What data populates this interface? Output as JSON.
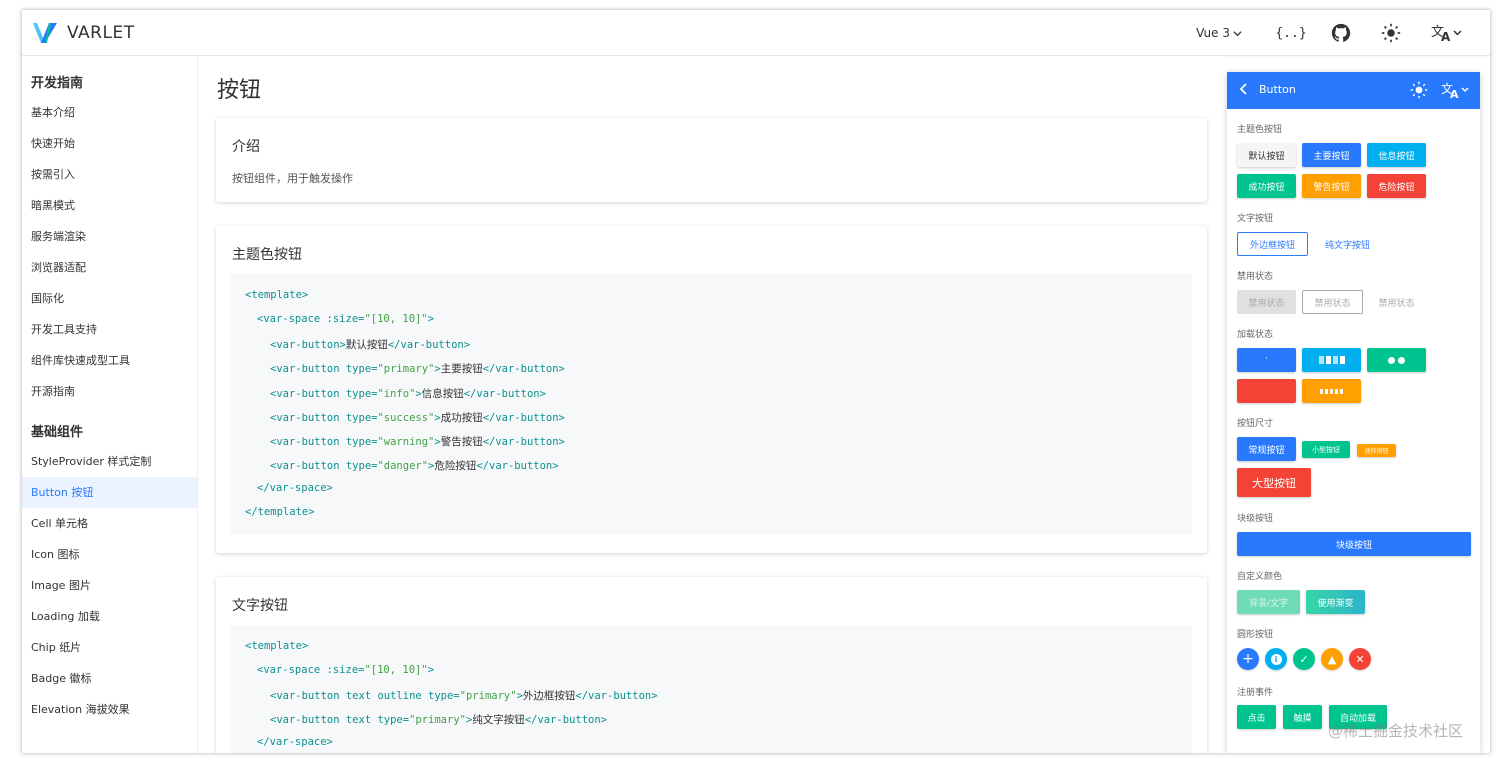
{
  "header": {
    "brand": "VARLET",
    "version": "Vue 3",
    "icons": [
      "logo-icon",
      "code-playground-icon",
      "github-icon",
      "theme-sun-icon",
      "language-icon"
    ]
  },
  "sidebar": {
    "groups": [
      {
        "title": "开发指南",
        "items": [
          "基本介绍",
          "快速开始",
          "按需引入",
          "暗黑模式",
          "服务端渲染",
          "浏览器适配",
          "国际化",
          "开发工具支持",
          "组件库快速成型工具",
          "开源指南"
        ]
      },
      {
        "title": "基础组件",
        "items": [
          "StyleProvider 样式定制",
          "Button 按钮",
          "Cell 单元格",
          "Icon 图标",
          "Image 图片",
          "Loading 加载",
          "Chip 纸片",
          "Badge 徽标",
          "Elevation 海拔效果"
        ]
      }
    ],
    "active": "Button 按钮"
  },
  "main": {
    "title": "按钮",
    "intro": {
      "title": "介绍",
      "text": "按钮组件，用于触发操作"
    },
    "theme_card": {
      "title": "主题色按钮",
      "code": {
        "l1": "<template>",
        "l2a": "<var-space :size=",
        "l2b": "\"[10, 10]\"",
        "l2c": ">",
        "l3a": "<var-button>",
        "l3b": "默认按钮",
        "l3c": "</var-button>",
        "l4a": "<var-button type=",
        "l4b": "\"primary\"",
        "l4c": ">",
        "l4d": "主要按钮",
        "l4e": "</var-button>",
        "l5a": "<var-button type=",
        "l5b": "\"info\"",
        "l5c": ">",
        "l5d": "信息按钮",
        "l5e": "</var-button>",
        "l6a": "<var-button type=",
        "l6b": "\"success\"",
        "l6c": ">",
        "l6d": "成功按钮",
        "l6e": "</var-button>",
        "l7a": "<var-button type=",
        "l7b": "\"warning\"",
        "l7c": ">",
        "l7d": "警告按钮",
        "l7e": "</var-button>",
        "l8a": "<var-button type=",
        "l8b": "\"danger\"",
        "l8c": ">",
        "l8d": "危险按钮",
        "l8e": "</var-button>",
        "l9": "</var-space>",
        "l10": "</template>"
      }
    },
    "text_card": {
      "title": "文字按钮",
      "code": {
        "l1": "<template>",
        "l2a": "<var-space :size=",
        "l2b": "\"[10, 10]\"",
        "l2c": ">",
        "l3a": "<var-button text outline type=",
        "l3b": "\"primary\"",
        "l3c": ">",
        "l3d": "外边框按钮",
        "l3e": "</var-button>",
        "l4a": "<var-button text type=",
        "l4b": "\"primary\"",
        "l4c": ">",
        "l4d": "纯文字按钮",
        "l4e": "</var-button>",
        "l5": "</var-space>"
      }
    }
  },
  "preview": {
    "title": "Button",
    "sections": {
      "theme": "主题色按钮",
      "text": "文字按钮",
      "disabled": "禁用状态",
      "loading": "加载状态",
      "size": "按钮尺寸",
      "block": "块级按钮",
      "custom": "自定义颜色",
      "round": "圆形按钮",
      "events": "注册事件"
    },
    "buttons": {
      "default": "默认按钮",
      "primary": "主要按钮",
      "info": "信息按钮",
      "success": "成功按钮",
      "warning": "警告按钮",
      "danger": "危险按钮",
      "outline": "外边框按钮",
      "plain": "纯文字按钮",
      "disabled": "禁用状态",
      "normal": "常规按钮",
      "small": "小型按钮",
      "mini": "迷你按钮",
      "large": "大型按钮",
      "block": "块级按钮",
      "bg_text": "背景/文字",
      "gradient": "使用渐变",
      "click": "点击",
      "touch": "触摸",
      "auto_load": "自动加载"
    },
    "colors": {
      "primary": "#2979ff",
      "info": "#00afef",
      "success": "#00c48f",
      "warning": "#ff9f00",
      "danger": "#f44336"
    }
  },
  "watermark": "@稀土掘金技术社区"
}
